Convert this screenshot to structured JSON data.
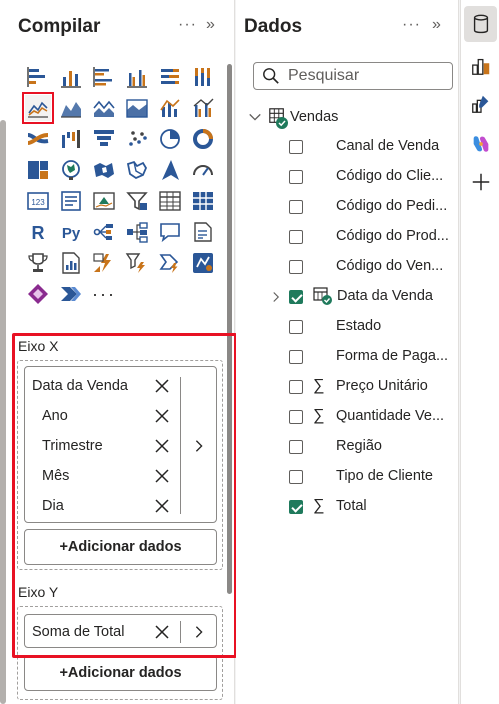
{
  "build": {
    "title": "Compilar",
    "more_label": "···",
    "collapse_label": "»",
    "viz_more": "···",
    "x_axis": {
      "label": "Eixo X",
      "fields": [
        {
          "label": "Data da Venda",
          "indent": false
        },
        {
          "label": "Ano",
          "indent": true
        },
        {
          "label": "Trimestre",
          "indent": true
        },
        {
          "label": "Mês",
          "indent": true
        },
        {
          "label": "Dia",
          "indent": true
        }
      ],
      "add_label": "+Adicionar dados"
    },
    "y_axis": {
      "label": "Eixo Y",
      "field": "Soma de Total",
      "add_label": "+Adicionar dados"
    }
  },
  "data_pane": {
    "title": "Dados",
    "more_label": "···",
    "collapse_label": "»",
    "search_placeholder": "Pesquisar",
    "table": "Vendas",
    "fields": [
      {
        "label": "Canal de Venda",
        "checked": false,
        "sigma": false
      },
      {
        "label": "Código do Clie...",
        "checked": false,
        "sigma": false
      },
      {
        "label": "Código do Pedi...",
        "checked": false,
        "sigma": false
      },
      {
        "label": "Código do Prod...",
        "checked": false,
        "sigma": false
      },
      {
        "label": "Código do Ven...",
        "checked": false,
        "sigma": false
      },
      {
        "label": "Data da Venda",
        "checked": true,
        "sigma": false,
        "hierarchy": true
      },
      {
        "label": "Estado",
        "checked": false,
        "sigma": false
      },
      {
        "label": "Forma de Paga...",
        "checked": false,
        "sigma": false
      },
      {
        "label": "Preço Unitário",
        "checked": false,
        "sigma": true
      },
      {
        "label": "Quantidade Ve...",
        "checked": false,
        "sigma": true
      },
      {
        "label": "Região",
        "checked": false,
        "sigma": false
      },
      {
        "label": "Tipo de Cliente",
        "checked": false,
        "sigma": false
      },
      {
        "label": "Total",
        "checked": true,
        "sigma": true
      }
    ]
  },
  "colors": {
    "highlight": "#e81123",
    "checked": "#1f7a5c",
    "accent_orange": "#c8741a",
    "accent_blue": "#2b5797"
  },
  "rail": [
    "data-icon",
    "build-visual-icon",
    "format-icon",
    "copilot-icon",
    "add-icon"
  ]
}
